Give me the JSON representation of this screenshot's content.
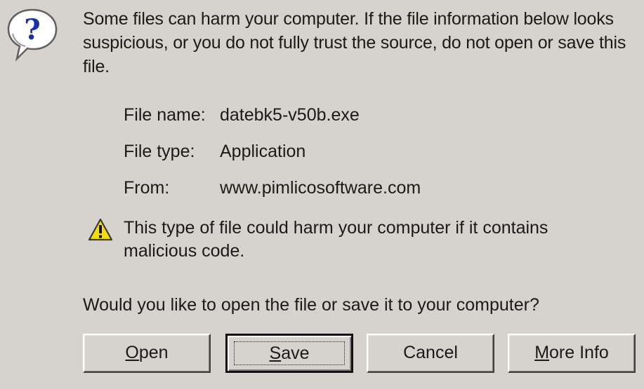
{
  "dialog": {
    "icon": "question-bubble-icon",
    "intro": "Some files can harm your computer. If the file information below looks suspicious, or you do not fully trust the source, do not open or save this file.",
    "file_info": {
      "name_label": "File name:",
      "name_value": "datebk5-v50b.exe",
      "type_label": "File type:",
      "type_value": "Application",
      "from_label": "From:",
      "from_value": "www.pimlicosoftware.com"
    },
    "warning": {
      "icon": "warning-triangle-icon",
      "text": "This type of file could harm your computer if it contains malicious code."
    },
    "question": "Would you like to open the file or save it to your computer?"
  },
  "buttons": {
    "open": {
      "mnemonic": "O",
      "rest": "pen"
    },
    "save": {
      "mnemonic": "S",
      "rest": "ave"
    },
    "cancel": {
      "label": "Cancel"
    },
    "more_info": {
      "mnemonic": "M",
      "rest": "ore Info"
    }
  },
  "colors": {
    "dialog_bg": "#d6d3ce",
    "icon_blue": "#1a2fb0",
    "warning_yellow": "#f5e000"
  }
}
